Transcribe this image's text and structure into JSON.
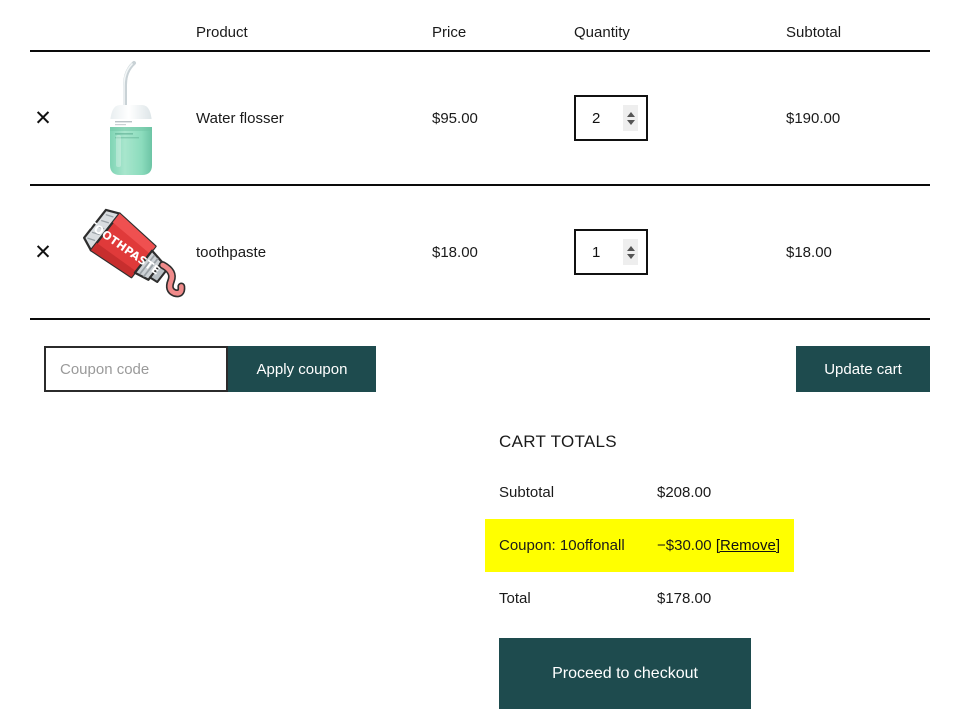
{
  "table": {
    "headers": {
      "remove": "",
      "thumbnail": "",
      "product": "Product",
      "price": "Price",
      "quantity": "Quantity",
      "subtotal": "Subtotal"
    },
    "rows": [
      {
        "remove_icon": "close-icon",
        "thumbnail_icon": "water-flosser-product-image",
        "name": "Water flosser",
        "price": "$95.00",
        "quantity": "2",
        "subtotal": "$190.00"
      },
      {
        "remove_icon": "close-icon",
        "thumbnail_icon": "toothpaste-tube-product-image",
        "name": "toothpaste",
        "price": "$18.00",
        "quantity": "1",
        "subtotal": "$18.00"
      }
    ]
  },
  "coupon": {
    "placeholder": "Coupon code",
    "value": "",
    "apply_label": "Apply coupon"
  },
  "update_cart_label": "Update cart",
  "totals": {
    "title": "CART TOTALS",
    "subtotal_label": "Subtotal",
    "subtotal_value": "$208.00",
    "coupon_label": "Coupon: 10offonall",
    "coupon_value": "−$30.00",
    "coupon_remove_label": "[Remove]",
    "total_label": "Total",
    "total_value": "$178.00",
    "checkout_label": "Proceed to checkout"
  },
  "colors": {
    "button": "#1e4b4e",
    "highlight": "#ffff00",
    "border": "#0a0a0a",
    "product_green": "#9fe0c6",
    "product_red": "#e03a3a"
  }
}
